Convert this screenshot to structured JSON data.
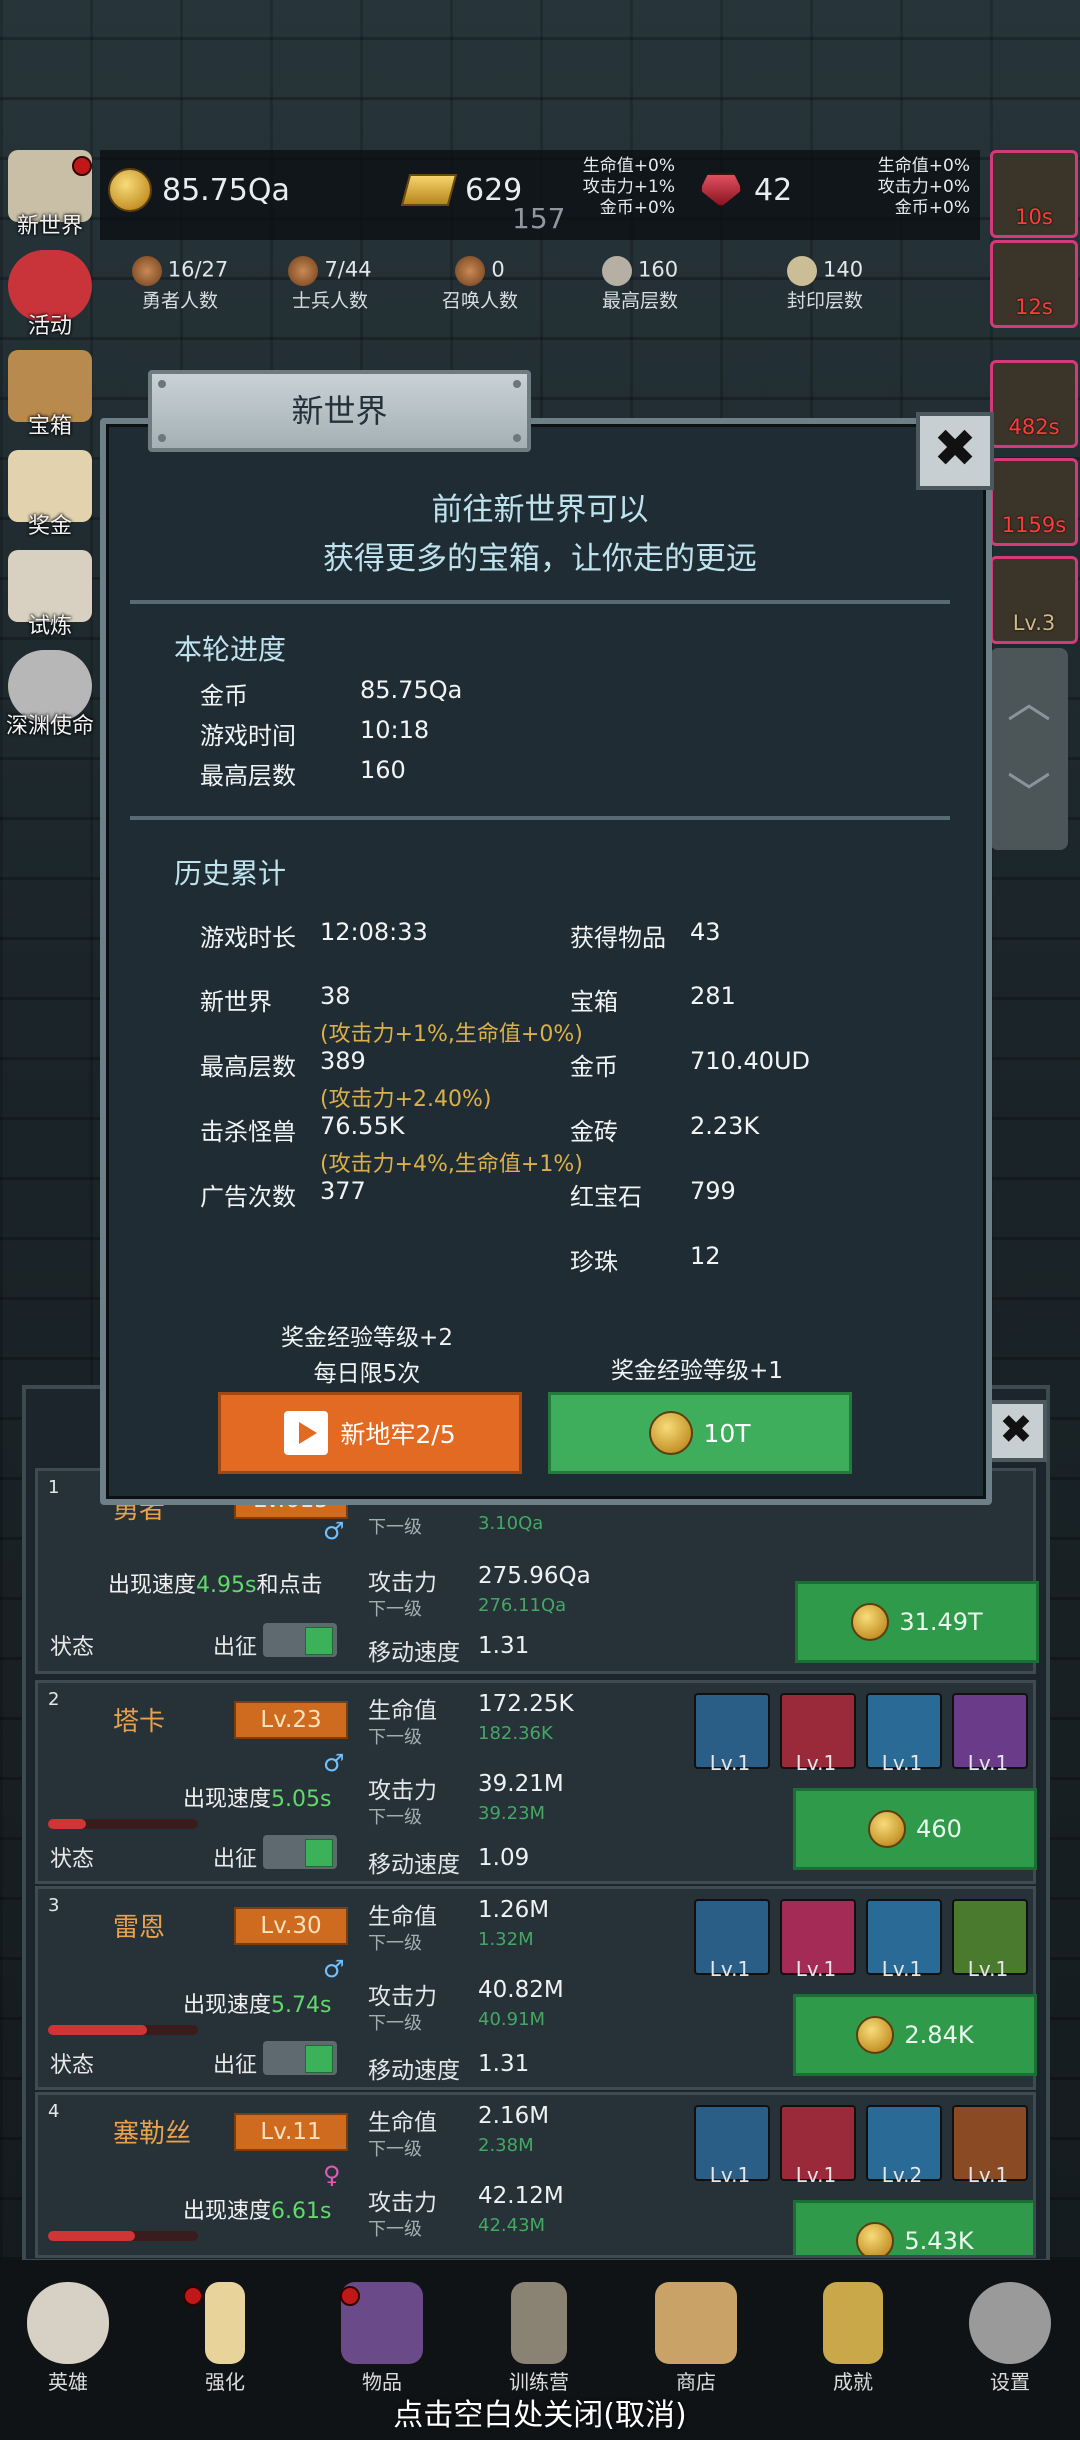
{
  "top": {
    "coins": "85.75Qa",
    "gold_bars": "629",
    "rubies": "42",
    "center_number": "157",
    "bonus_left": [
      "生命值+0%",
      "攻击力+1%",
      "金币+0%"
    ],
    "bonus_right": [
      "生命值+0%",
      "攻击力+0%",
      "金币+0%"
    ],
    "stats": [
      {
        "value": "16/27",
        "label": "勇者人数"
      },
      {
        "value": "7/44",
        "label": "士兵人数"
      },
      {
        "value": "0",
        "label": "召唤人数"
      },
      {
        "value": "160",
        "label": "最高层数"
      },
      {
        "value": "140",
        "label": "封印层数"
      }
    ]
  },
  "side_menu": [
    "新世界",
    "活动",
    "宝箱",
    "奖金",
    "试炼",
    "深渊使命"
  ],
  "buffs": [
    "10s",
    "12s",
    "482s",
    "1159s",
    "Lv.3"
  ],
  "dialog": {
    "tab_title": "新世界",
    "close_icon": "close-icon",
    "intro_line1": "前往新世界可以",
    "intro_line2": "获得更多的宝箱，让你走的更远",
    "round_title": "本轮进度",
    "round": [
      {
        "label": "金币",
        "value": "85.75Qa"
      },
      {
        "label": "游戏时间",
        "value": "10:18"
      },
      {
        "label": "最高层数",
        "value": "160"
      }
    ],
    "history_title": "历史累计",
    "history_left": [
      {
        "label": "游戏时长",
        "value": "12:08:33",
        "note": ""
      },
      {
        "label": "新世界",
        "value": "38",
        "note": "(攻击力+1%,生命值+0%)"
      },
      {
        "label": "最高层数",
        "value": "389",
        "note": "(攻击力+2.40%)"
      },
      {
        "label": "击杀怪兽",
        "value": "76.55K",
        "note": "(攻击力+4%,生命值+1%)"
      },
      {
        "label": "广告次数",
        "value": "377",
        "note": ""
      }
    ],
    "history_right": [
      {
        "label": "获得物品",
        "value": "43"
      },
      {
        "label": "宝箱",
        "value": "281"
      },
      {
        "label": "金币",
        "value": "710.40UD"
      },
      {
        "label": "金砖",
        "value": "2.23K"
      },
      {
        "label": "红宝石",
        "value": "799"
      },
      {
        "label": "珍珠",
        "value": "12"
      }
    ],
    "left_btn_caption1": "奖金经验等级+2",
    "left_btn_caption2": "每日限5次",
    "right_btn_caption": "奖金经验等级+1",
    "left_btn_label": "新地牢2/5",
    "right_btn_label": "10T"
  },
  "heroes": [
    {
      "idx": "1",
      "name": "勇者",
      "level": "Lv.615",
      "sex": "♂",
      "speed_prefix": "出现速度",
      "speed": "4.95s",
      "speed_suffix": "和点击",
      "hp": "",
      "hp_next": "3.10Qa",
      "atk": "275.96Qa",
      "atk_next": "276.11Qa",
      "move": "1.31",
      "cost": "31.49T",
      "hp_fill": 0
    },
    {
      "idx": "2",
      "name": "塔卡",
      "level": "Lv.23",
      "sex": "♂",
      "speed_prefix": "出现速度",
      "speed": "5.05s",
      "speed_suffix": "",
      "hp": "172.25K",
      "hp_next": "182.36K",
      "atk": "39.21M",
      "atk_next": "39.23M",
      "move": "1.09",
      "cost": "460",
      "hp_fill": 0.25,
      "skills": [
        "Lv.1",
        "Lv.1",
        "Lv.1",
        "Lv.1"
      ]
    },
    {
      "idx": "3",
      "name": "雷恩",
      "level": "Lv.30",
      "sex": "♂",
      "speed_prefix": "出现速度",
      "speed": "5.74s",
      "speed_suffix": "",
      "hp": "1.26M",
      "hp_next": "1.32M",
      "atk": "40.82M",
      "atk_next": "40.91M",
      "move": "1.31",
      "cost": "2.84K",
      "hp_fill": 0.66,
      "skills": [
        "Lv.1",
        "Lv.1",
        "Lv.1",
        "Lv.1"
      ]
    },
    {
      "idx": "4",
      "name": "塞勒丝",
      "level": "Lv.11",
      "sex": "♀",
      "speed_prefix": "出现速度",
      "speed": "6.61s",
      "speed_suffix": "",
      "hp": "2.16M",
      "hp_next": "2.38M",
      "atk": "42.12M",
      "atk_next": "42.43M",
      "move": "",
      "cost": "5.43K",
      "hp_fill": 0.58,
      "skills": [
        "Lv.1",
        "Lv.1",
        "Lv.2",
        "Lv.1"
      ]
    }
  ],
  "labels": {
    "hp": "生命值",
    "next": "下一级",
    "atk": "攻击力",
    "move": "移动速度",
    "state": "状态",
    "deploy": "出征"
  },
  "nav": [
    "英雄",
    "强化",
    "物品",
    "训练营",
    "商店",
    "成就",
    "设置"
  ],
  "hint": "点击空白处关闭(取消)",
  "colors": {
    "accent_orange": "#e36a22",
    "accent_green": "#3fae5c",
    "gold_text": "#d9b04a",
    "cyan_text": "#bfe3ee"
  }
}
